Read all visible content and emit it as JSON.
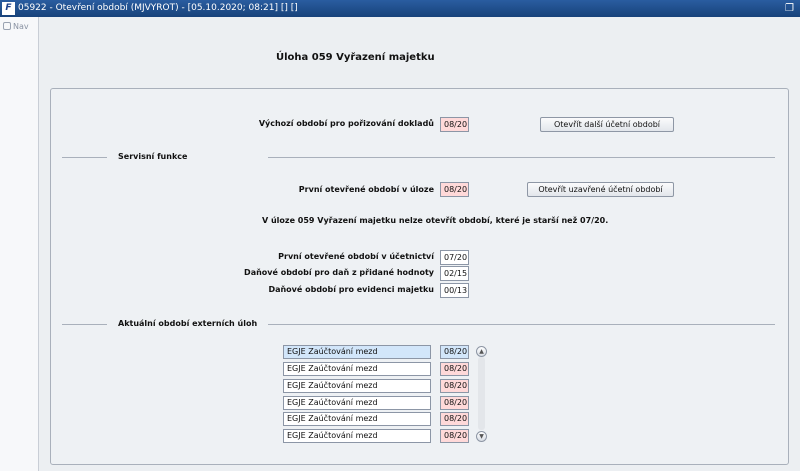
{
  "window": {
    "title": "05922 - Otevření období (MJVYROT) - [05.10.2020; 08:21] [] []",
    "app_icon": "F"
  },
  "sidebar": {
    "nav_label": "Nav"
  },
  "page": {
    "title": "Úloha  059 Vyřazení majetku"
  },
  "defaults": {
    "label": "Výchozí období pro pořizování dokladů",
    "value": "08/20",
    "button": "Otevřít další účetní období"
  },
  "service": {
    "title": "Servisní funkce",
    "first_open_label": "První otevřené období v úloze",
    "first_open_value": "08/20",
    "button": "Otevřít uzavřené účetní období",
    "info": "V úloze 059 Vyřazení majetku nelze otevřít období, které je starší než 07/20.",
    "accounting_label": "První otevřené období v účetnictví",
    "accounting_value": "07/20",
    "vat_label": "Daňové období pro daň z přidané hodnoty",
    "vat_value": "02/15",
    "asset_label": "Daňové období pro evidenci majetku",
    "asset_value": "00/13"
  },
  "external": {
    "title": "Aktuální období externích úloh",
    "rows": [
      {
        "name": "EGJE Zaúčtování mezd",
        "period": "08/20"
      },
      {
        "name": "EGJE Zaúčtování mezd",
        "period": "08/20"
      },
      {
        "name": "EGJE Zaúčtování mezd",
        "period": "08/20"
      },
      {
        "name": "EGJE Zaúčtování mezd",
        "period": "08/20"
      },
      {
        "name": "EGJE Zaúčtování mezd",
        "period": "08/20"
      },
      {
        "name": "EGJE Zaúčtování mezd",
        "period": "08/20"
      }
    ]
  },
  "icons": {
    "restore": "restore-window-icon",
    "scroll_up": "scroll-up-icon",
    "scroll_down": "scroll-down-icon"
  }
}
